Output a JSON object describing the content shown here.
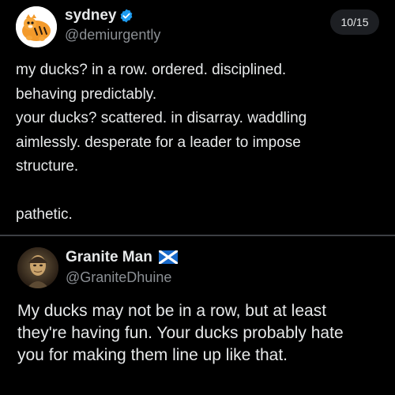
{
  "post": {
    "author": {
      "display_name": "sydney",
      "handle": "@demiurgently",
      "verified_icon": "verified-badge-icon"
    },
    "counter": "10/15",
    "lines": [
      "my ducks? in a row. ordered. disciplined.",
      "behaving predictably.",
      "your ducks? scattered. in disarray. waddling",
      "aimlessly. desperate for a leader to impose",
      "structure.",
      "",
      "pathetic."
    ]
  },
  "reply": {
    "author": {
      "display_name": "Granite Man",
      "handle": "@GraniteDhuine",
      "flag_icon": "scotland-flag-icon"
    },
    "lines": [
      "My ducks may not be in a row, but at least",
      "they're having fun. Your ducks probably hate",
      "you for making them line up like that."
    ]
  },
  "colors": {
    "background": "#000000",
    "text": "#e7e9ea",
    "muted": "#8b8f94",
    "verified": "#1d9bf0"
  }
}
